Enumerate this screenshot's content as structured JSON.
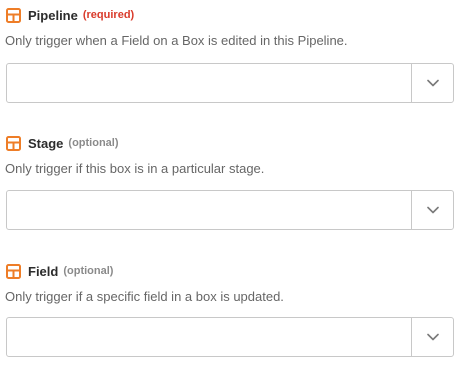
{
  "accent_color": "#ee7d27",
  "fields": [
    {
      "label": "Pipeline",
      "tag": "(required)",
      "tag_type": "required",
      "help": "Only trigger when a Field on a Box is edited in this Pipeline.",
      "value": "",
      "icon": "field-layout-icon"
    },
    {
      "label": "Stage",
      "tag": "(optional)",
      "tag_type": "optional",
      "help": "Only trigger if this box is in a particular stage.",
      "value": "",
      "icon": "field-layout-icon"
    },
    {
      "label": "Field",
      "tag": "(optional)",
      "tag_type": "optional",
      "help": "Only trigger if a specific field in a box is updated.",
      "value": "",
      "icon": "field-layout-icon"
    }
  ],
  "dropdown_icon": "chevron-down-icon"
}
